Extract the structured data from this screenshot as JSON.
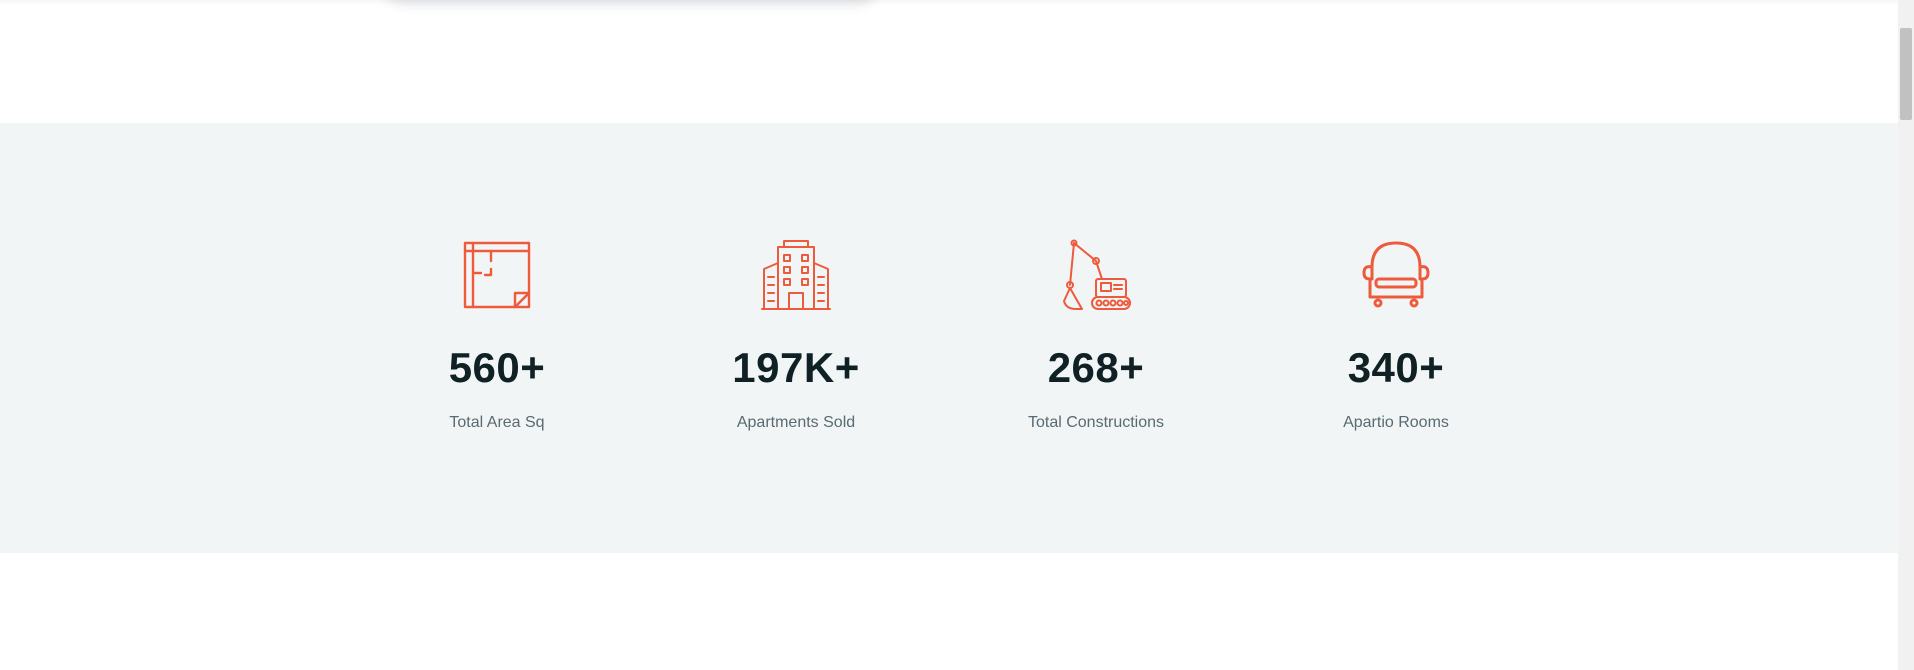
{
  "stats": [
    {
      "icon": "floor-plan-icon",
      "value": "560+",
      "label": "Total Area Sq"
    },
    {
      "icon": "building-icon",
      "value": "197K+",
      "label": "Apartments Sold"
    },
    {
      "icon": "excavator-icon",
      "value": "268+",
      "label": "Total Constructions"
    },
    {
      "icon": "armchair-icon",
      "value": "340+",
      "label": "Apartio Rooms"
    }
  ],
  "colors": {
    "accent": "#ee5a3c",
    "value_text": "#0f2124",
    "label_text": "#586a72",
    "band_background": "#f2f5f6"
  }
}
